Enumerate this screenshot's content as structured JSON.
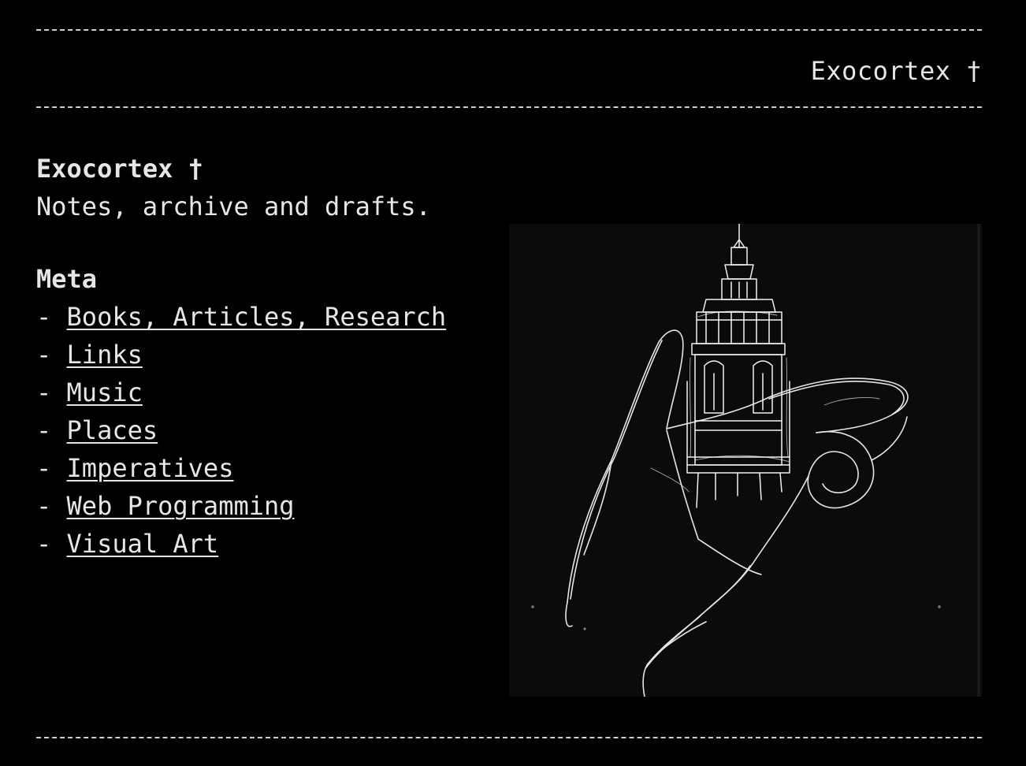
{
  "header": {
    "site_title": "Exocortex †"
  },
  "intro": {
    "title": "Exocortex †",
    "tagline": "Notes, archive and drafts."
  },
  "meta": {
    "heading": "Meta",
    "bullet": "- ",
    "links": [
      {
        "label": "Books, Articles, Research"
      },
      {
        "label": "Links"
      },
      {
        "label": "Music"
      },
      {
        "label": "Places"
      },
      {
        "label": "Imperatives"
      },
      {
        "label": "Web Programming"
      },
      {
        "label": "Visual Art"
      }
    ]
  },
  "artwork": {
    "subject": "white line sketch of a hand holding a tower",
    "background_color": "#0b0b0b",
    "line_color": "#f2f2f2"
  },
  "colors": {
    "background": "#000000",
    "text": "#e6e6e6",
    "rule": "#cfcfcf"
  }
}
